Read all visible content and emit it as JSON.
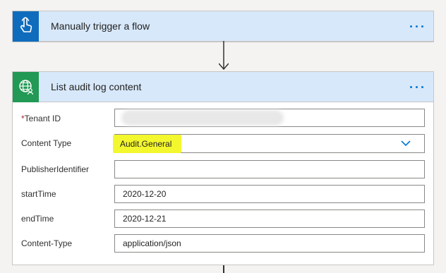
{
  "trigger_card": {
    "title": "Manually trigger a flow",
    "icon": "hand-touch-icon",
    "icon_color": "#0f6cbd"
  },
  "action_card": {
    "title": "List audit log content",
    "icon": "globe-user-icon",
    "icon_color": "#229954",
    "fields": [
      {
        "label": "Tenant ID",
        "required": true,
        "value": ""
      },
      {
        "label": "Content Type",
        "required": false,
        "value": "Audit.General"
      },
      {
        "label": "PublisherIdentifier",
        "required": false,
        "value": ""
      },
      {
        "label": "startTime",
        "required": false,
        "value": "2020-12-20"
      },
      {
        "label": "endTime",
        "required": false,
        "value": "2020-12-21"
      },
      {
        "label": "Content-Type",
        "required": false,
        "value": "application/json"
      }
    ]
  },
  "required_marker": "*",
  "colors": {
    "accent": "#0078d4",
    "header_bg": "#d7e8fa",
    "highlight": "#f3f72e"
  }
}
